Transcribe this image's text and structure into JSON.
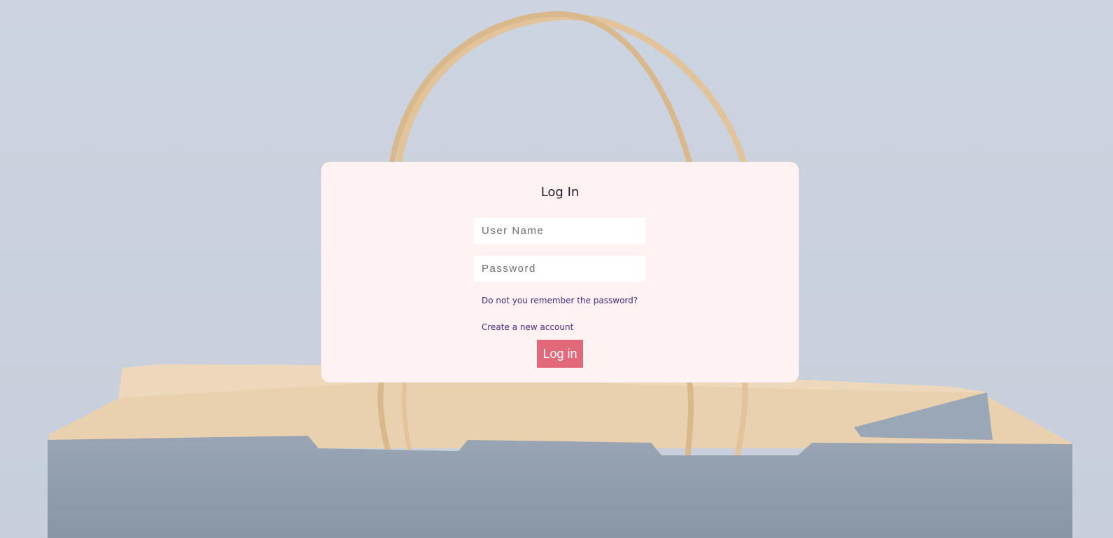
{
  "login": {
    "title": "Log In",
    "username_placeholder": "User Name",
    "password_placeholder": "Password",
    "forgot_password_link": "Do not you remember the password?",
    "create_account_link": "Create a new account",
    "submit_label": "Log in"
  },
  "colors": {
    "page_background": "#cdd5e0",
    "card_background": "#fff2f2",
    "button_background": "#e2697a",
    "link_color": "#4b2a7a",
    "bag_paper": "#e8cfae",
    "bag_blue": "#8e9bab"
  }
}
